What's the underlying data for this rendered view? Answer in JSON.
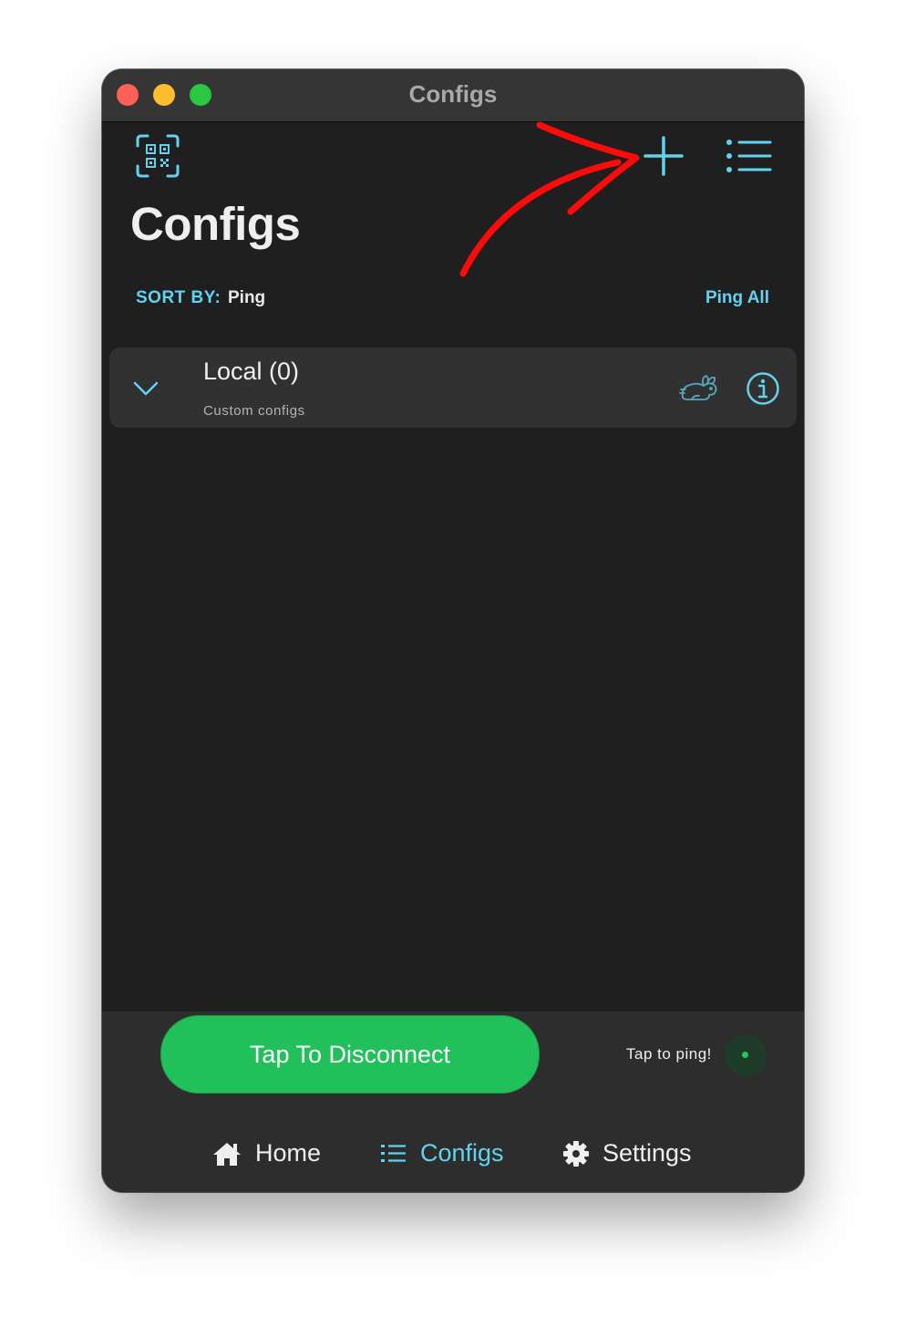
{
  "window": {
    "title": "Configs"
  },
  "header": {
    "page_title": "Configs",
    "sort_label": "SORT BY:",
    "sort_value": "Ping",
    "ping_all_label": "Ping All"
  },
  "groups": [
    {
      "name": "Local (0)",
      "subtitle": "Custom configs"
    }
  ],
  "bottom": {
    "disconnect_label": "Tap To Disconnect",
    "tap_ping_label": "Tap to ping!"
  },
  "nav": {
    "home_label": "Home",
    "configs_label": "Configs",
    "settings_label": "Settings",
    "active": "configs"
  },
  "icons": {
    "qr_scan": "qr-scan-icon",
    "add": "plus-icon",
    "menu": "list-icon",
    "expand": "chevron-down-icon",
    "speed": "rabbit-icon",
    "info": "info-icon",
    "home": "home-icon",
    "configs": "list-icon",
    "settings": "gear-icon",
    "annotation": "red-arrow-annotation"
  },
  "colors": {
    "accent": "#63d2ee",
    "connect_green": "#22c05a",
    "background": "#1f1f1f",
    "annotation_red": "#ff0a0a"
  }
}
